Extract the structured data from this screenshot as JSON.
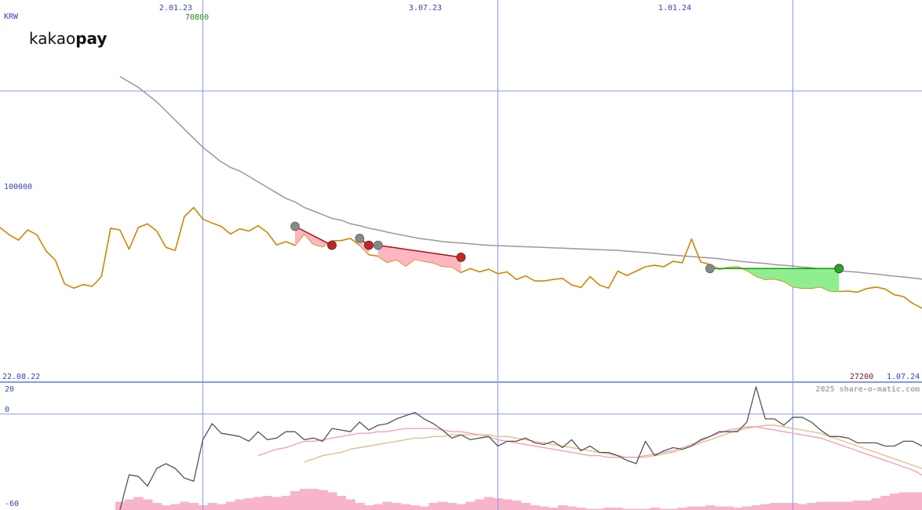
{
  "chart_data": {
    "type": "line",
    "currency": "KRW",
    "logo": {
      "light": "kakao",
      "bold": "pay"
    },
    "date_ticks": [
      "2.01.23",
      "3.07.23",
      "1.01.24"
    ],
    "start_date": "22.08.22",
    "end_date": "1.07.24",
    "price_gridline": "100000",
    "high_label": "70800",
    "low_label": "27200",
    "watermark": "2025 share-o-matic.com",
    "osc_ticks": [
      "20",
      "0",
      "-60"
    ],
    "price_ylim": [
      20000,
      125000
    ],
    "osc_ylim": [
      -60,
      20
    ],
    "colors": {
      "price": "#cc8800",
      "ma": "#999999",
      "osc": "#555555",
      "osc_fast": "#f4a0b8",
      "osc_slow": "#e0c090",
      "volume": "#f8b4c8",
      "grid": "#8899ee",
      "axis_text": "#3344bb",
      "high_text": "#228822",
      "low_text": "#772222",
      "gain": "#90ee90",
      "loss": "#ffb6c1",
      "gain_line": "#119911",
      "loss_line": "#aa1111"
    },
    "series": [
      {
        "name": "price",
        "values": [
          62500,
          60500,
          59000,
          61800,
          60500,
          56000,
          53500,
          47000,
          45800,
          46800,
          46300,
          49000,
          62300,
          61800,
          56500,
          62500,
          63500,
          61500,
          57000,
          56200,
          65500,
          68000,
          64800,
          63700,
          62800,
          60700,
          62100,
          61500,
          63000,
          61100,
          57700,
          58600,
          57600,
          60800,
          57900,
          57200,
          58800,
          58900,
          59500,
          57600,
          55000,
          54600,
          52900,
          53700,
          51900,
          53800,
          53200,
          52800,
          51800,
          51700,
          50100,
          51200,
          50300,
          51000,
          49800,
          50300,
          48200,
          49200,
          47800,
          47800,
          48200,
          48500,
          46700,
          46000,
          49000,
          46700,
          45800,
          50500,
          49300,
          50500,
          51700,
          52100,
          51700,
          53200,
          52800,
          59300,
          53000,
          52300,
          51000,
          51500,
          51700,
          50700,
          49100,
          48200,
          48400,
          47700,
          46200,
          45800,
          45800,
          46200,
          45000,
          44900,
          45000,
          44700,
          45700,
          46100,
          45600,
          44000,
          43500,
          41600,
          40300
        ]
      },
      {
        "name": "moving_average",
        "values": [
          null,
          null,
          null,
          null,
          null,
          null,
          null,
          null,
          null,
          null,
          null,
          null,
          null,
          104000,
          102500,
          101000,
          99000,
          97000,
          94500,
          92000,
          89500,
          87000,
          84500,
          82500,
          80500,
          79000,
          78000,
          76500,
          75000,
          73500,
          72000,
          70500,
          69500,
          68000,
          67000,
          66000,
          65000,
          64500,
          63500,
          63000,
          62300,
          61800,
          61200,
          60700,
          60200,
          59700,
          59300,
          59000,
          58600,
          58400,
          58200,
          58000,
          57800,
          57600,
          57500,
          57400,
          57300,
          57200,
          57100,
          57000,
          56900,
          56800,
          56700,
          56600,
          56500,
          56400,
          56300,
          56200,
          56000,
          55800,
          55600,
          55400,
          55100,
          54900,
          54700,
          54500,
          54300,
          54100,
          53900,
          53600,
          53300,
          53000,
          52800,
          52600,
          52300,
          52100,
          51900,
          51600,
          51400,
          51100,
          50900,
          50600,
          50400,
          50200,
          49900,
          49700,
          49400,
          49100,
          48900,
          48600,
          48300
        ]
      },
      {
        "name": "oscillator",
        "values": [
          null,
          null,
          null,
          null,
          null,
          null,
          null,
          null,
          null,
          null,
          null,
          null,
          null,
          -60,
          -38,
          -39,
          -45,
          -34,
          -31,
          -34,
          -40,
          -42,
          -16,
          -6,
          -12,
          -13,
          -14,
          -17,
          -11,
          -16,
          -15,
          -11,
          -11,
          -16,
          -15,
          -17,
          -9,
          -10,
          -11,
          -5,
          -10,
          -7,
          -6,
          -3,
          -1,
          1,
          -3,
          -6,
          -10,
          -15,
          -13,
          -16,
          -15,
          -14,
          -20,
          -17,
          -17,
          -15,
          -18,
          -19,
          -17,
          -21,
          -16,
          -23,
          -20,
          -24,
          -24,
          -26,
          -29,
          -31,
          -17,
          -26,
          -23,
          -21,
          -22,
          -20,
          -16,
          -14,
          -11,
          -11,
          -11,
          -5,
          17,
          -3,
          -3,
          -7,
          -2,
          -2,
          -5,
          -10,
          -14,
          -14,
          -15,
          -18,
          -18,
          -18,
          -20,
          -20,
          -17,
          -17,
          -20,
          -22,
          -21,
          -26,
          -27,
          -30
        ]
      },
      {
        "name": "oscillator_fast",
        "values": [
          null,
          null,
          null,
          null,
          null,
          null,
          null,
          null,
          null,
          null,
          null,
          null,
          null,
          null,
          null,
          null,
          null,
          null,
          null,
          null,
          null,
          null,
          null,
          null,
          null,
          null,
          null,
          null,
          -26,
          -24,
          -22,
          -21,
          -19,
          -17,
          -17,
          -16,
          -15,
          -14,
          -13,
          -12,
          -12,
          -11,
          -11,
          -10,
          -9,
          -9,
          -9,
          -9,
          -10,
          -11,
          -11,
          -12,
          -13,
          -14,
          -16,
          -17,
          -18,
          -19,
          -20,
          -21,
          -22,
          -23,
          -24,
          -25,
          -26,
          -26,
          -27,
          -27,
          -27,
          -27,
          -26,
          -25,
          -24,
          -23,
          -21,
          -19,
          -17,
          -14,
          -12,
          -10,
          -9,
          -8,
          -8,
          -9,
          -10,
          -11,
          -12,
          -13,
          -14,
          -15,
          -17,
          -19,
          -21,
          -23,
          -25,
          -27,
          -29,
          -31,
          -33,
          -35,
          -38
        ]
      },
      {
        "name": "oscillator_slow",
        "values": [
          null,
          null,
          null,
          null,
          null,
          null,
          null,
          null,
          null,
          null,
          null,
          null,
          null,
          null,
          null,
          null,
          null,
          null,
          null,
          null,
          null,
          null,
          null,
          null,
          null,
          null,
          null,
          null,
          null,
          null,
          null,
          null,
          null,
          -30,
          -28,
          -26,
          -25,
          -24,
          -22,
          -21,
          -20,
          -19,
          -18,
          -17,
          -16,
          -15,
          -15,
          -14,
          -14,
          -13,
          -13,
          -13,
          -13,
          -13,
          -14,
          -14,
          -15,
          -16,
          -17,
          -18,
          -19,
          -20,
          -21,
          -22,
          -23,
          -24,
          -25,
          -26,
          -27,
          -27,
          -27,
          -26,
          -25,
          -24,
          -22,
          -20,
          -18,
          -16,
          -14,
          -12,
          -10,
          -9,
          -8,
          -7,
          -7,
          -8,
          -9,
          -10,
          -11,
          -12,
          -14,
          -16,
          -18,
          -20,
          -22,
          -24,
          -26,
          -28,
          -30,
          -32,
          -34
        ]
      },
      {
        "name": "volume",
        "values": [
          null,
          null,
          null,
          null,
          null,
          null,
          null,
          null,
          null,
          null,
          null,
          null,
          null,
          0.35,
          0.45,
          0.55,
          0.45,
          0.3,
          0.2,
          0.25,
          0.35,
          0.3,
          0.2,
          0.3,
          0.25,
          0.35,
          0.45,
          0.5,
          0.55,
          0.6,
          0.55,
          0.6,
          0.8,
          0.9,
          0.9,
          0.85,
          0.75,
          0.6,
          0.45,
          0.3,
          0.2,
          0.25,
          0.35,
          0.3,
          0.25,
          0.2,
          0.15,
          0.3,
          0.35,
          0.3,
          0.25,
          0.35,
          0.45,
          0.55,
          0.5,
          0.45,
          0.4,
          0.3,
          0.2,
          0.15,
          0.1,
          0.2,
          0.15,
          0.1,
          0.05,
          0.05,
          0.1,
          0.1,
          0.05,
          0.05,
          0.05,
          0.1,
          0.05,
          0.05,
          0.1,
          0.15,
          0.15,
          0.2,
          0.15,
          0.15,
          0.1,
          0.15,
          0.2,
          0.25,
          0.3,
          0.3,
          0.3,
          0.25,
          0.3,
          0.35,
          0.35,
          0.35,
          0.35,
          0.4,
          0.4,
          0.5,
          0.6,
          0.7,
          0.75,
          0.75,
          0.75
        ]
      }
    ],
    "signals": [
      {
        "kind": "loss",
        "from": [
          32,
          62800
        ],
        "to": [
          36,
          57600
        ]
      },
      {
        "kind": "loss",
        "from": [
          39,
          59500
        ],
        "to": [
          40,
          57600
        ]
      },
      {
        "kind": "loss",
        "from": [
          41,
          57600
        ],
        "to": [
          50,
          54300
        ]
      },
      {
        "kind": "gain",
        "from": [
          77,
          51200
        ],
        "to": [
          91,
          51200
        ]
      }
    ]
  }
}
